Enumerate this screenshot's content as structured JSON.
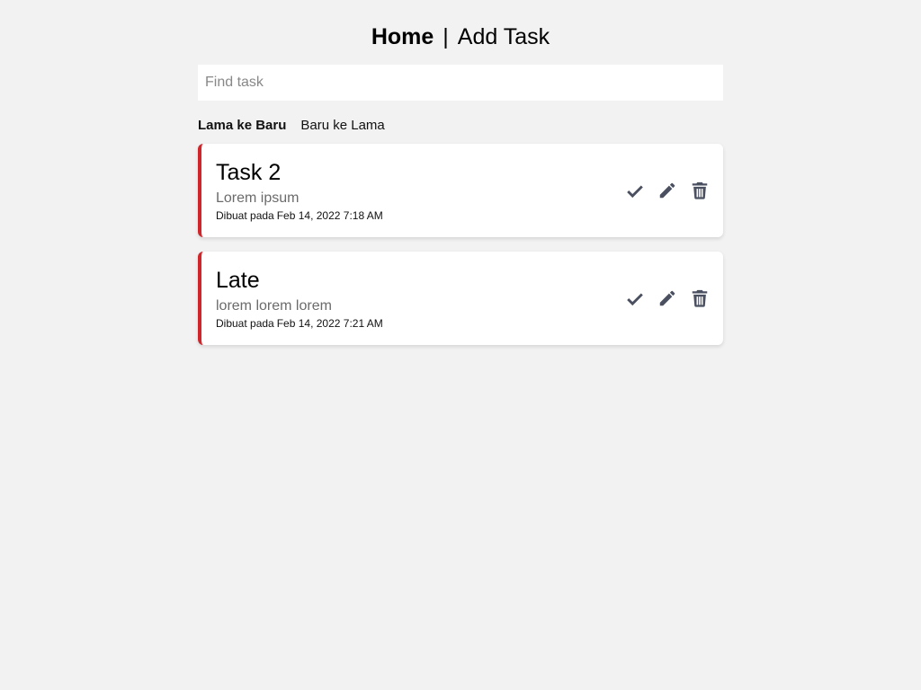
{
  "nav": {
    "home_label": "Home",
    "separator": "|",
    "add_label": "Add Task"
  },
  "search": {
    "placeholder": "Find task",
    "value": ""
  },
  "sort": {
    "options": [
      "Lama ke Baru",
      "Baru ke Lama"
    ],
    "active": "Lama ke Baru"
  },
  "colors": {
    "background": "#f2f2f2",
    "card_accent": "#d0262b",
    "icon": "#4a5060"
  },
  "tasks": [
    {
      "title": "Task 2",
      "description": "Lorem ipsum",
      "created_prefix": "Dibuat pada",
      "created_at": "Feb 14, 2022 7:18 AM",
      "actions": [
        "check-icon",
        "pencil-icon",
        "trash-icon"
      ]
    },
    {
      "title": "Late",
      "description": "lorem lorem lorem",
      "created_prefix": "Dibuat pada",
      "created_at": "Feb 14, 2022 7:21 AM",
      "actions": [
        "check-icon",
        "pencil-icon",
        "trash-icon"
      ]
    }
  ]
}
